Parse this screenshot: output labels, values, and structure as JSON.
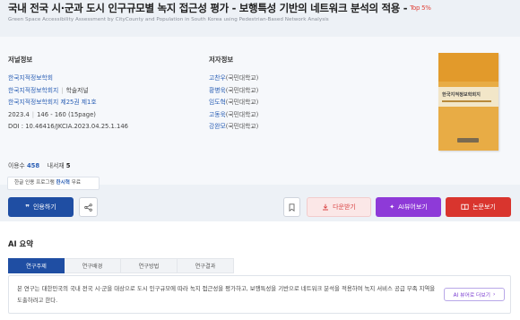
{
  "header": {
    "title": "국내 전국 시·군과 도시 인구규모별 녹지 접근성 평가 - 보행특성 기반의 네트워크 분석의 적용 -",
    "badge": "Top 5%",
    "subtitle": "Green Space Accessibility Assessment by CityCounty and Population in South Korea using Pedestrian-Based Network Analysis"
  },
  "journal": {
    "heading": "저널정보",
    "publisher": "한국지적정보학회",
    "journal_name": "한국지적정보학회지",
    "journal_type": "학술저널",
    "volume": "한국지적정보학회지 제25권 제1호",
    "date": "2023.4",
    "pages": "146 - 160 (15page)",
    "doi": "DOI : 10.46416/JKCIA.2023.04.25.1.146"
  },
  "authors": {
    "heading": "저자정보",
    "list": [
      {
        "name": "고찬우",
        "affil": "(국민대학교)"
      },
      {
        "name": "황병욱",
        "affil": "(국민대학교)"
      },
      {
        "name": "임도혁",
        "affil": "(국민대학교)"
      },
      {
        "name": "고동욱",
        "affil": "(국민대학교)"
      },
      {
        "name": "강완모",
        "affil": "(국민대학교)"
      }
    ]
  },
  "cover": {
    "title": "한국지적정보학회지"
  },
  "stats": {
    "usage_label": "이용수",
    "usage_value": "458",
    "saved_label": "내서재",
    "saved_value": "5"
  },
  "tooltip": {
    "prefix": "한글 인용 프로그램",
    "program": "한시혁",
    "suffix": "무료"
  },
  "actions": {
    "cite": "인용하기",
    "download": "다운받기",
    "ai_view": "AI뷰어보기",
    "paper_view": "논문보기"
  },
  "ai_summary": {
    "heading": "AI 요약",
    "tabs": [
      "연구주제",
      "연구배경",
      "연구방법",
      "연구결과"
    ],
    "text": "본 연구는 대한민국의 국내 전국 시·군을 대상으로 도시 인구규모에 따라 녹지 접근성을 평가하고, 보행특성을 기반으로 네트워크 분석을 적용하여 녹지 서비스 공급 부족 지역을 도출하려고 한다.",
    "more_button": "AI 뷰어로 더보기"
  },
  "colors": {
    "primary": "#1f4ea3",
    "link": "#2b5fb5",
    "ai_purple": "#8e3ad8",
    "view_red": "#d9352e",
    "badge_red": "#e0453c"
  }
}
